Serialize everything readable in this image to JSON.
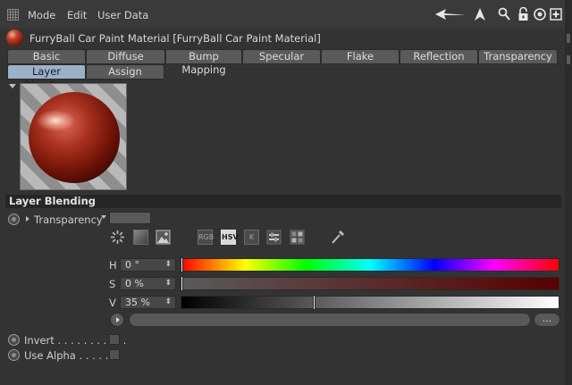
{
  "menubar": {
    "items": [
      "Mode",
      "Edit",
      "User Data"
    ]
  },
  "toolbar": {
    "icons": [
      "arrow-back-icon",
      "arrow-up-icon",
      "search-icon",
      "lock-icon",
      "target-icon",
      "add-icon"
    ]
  },
  "title": "FurryBall Car Paint Material [FurryBall Car Paint Material]",
  "tabs": {
    "row1": [
      "Basic",
      "Diffuse",
      "Bump Mapping",
      "Specular",
      "Flake",
      "Reflection",
      "Transparency"
    ],
    "row2": [
      "Layer Blending",
      "Assign"
    ],
    "active": "Layer Blending"
  },
  "section": {
    "header": "Layer Blending"
  },
  "transparency": {
    "label": "Transparency"
  },
  "color_modes": {
    "rgb": "RGB",
    "hsv": "HSV",
    "k": "K",
    "active": "HSV"
  },
  "hsv": {
    "h_label": "H",
    "h_value": "0 °",
    "h_fraction": 0,
    "s_label": "S",
    "s_value": "0 %",
    "s_fraction": 0,
    "v_label": "V",
    "v_value": "35 %",
    "v_fraction": 0.35
  },
  "more_label": "...",
  "invert": {
    "label": "Invert . . . . . . . . . . .",
    "checked": false
  },
  "use_alpha": {
    "label": "Use Alpha . . . . . .",
    "checked": false
  },
  "colors": {
    "active_tab": "#9bb1c8",
    "background": "#333333"
  }
}
